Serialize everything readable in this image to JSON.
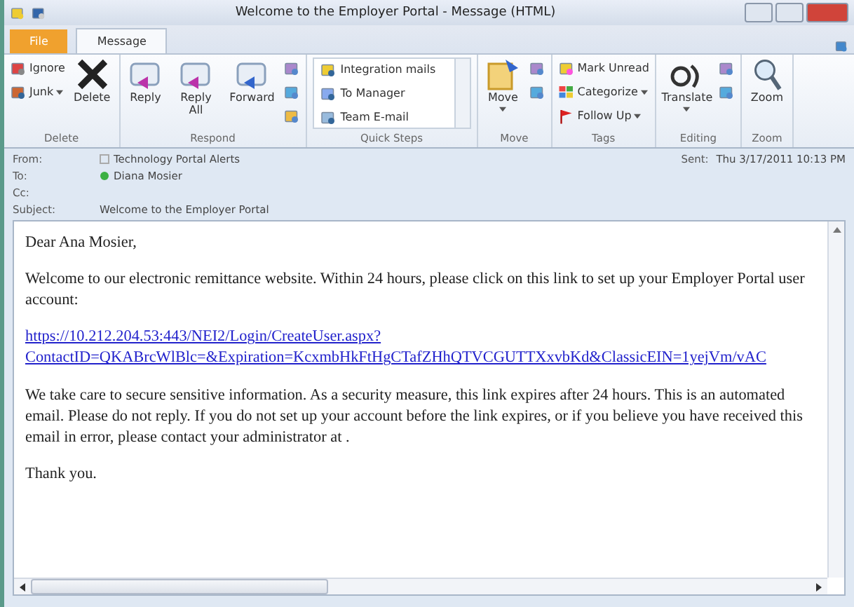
{
  "window": {
    "title": "Welcome to the Employer Portal  -  Message (HTML)"
  },
  "tabs": [
    {
      "label": "File",
      "kind": "file",
      "selected": false
    },
    {
      "label": "Message",
      "kind": "tab",
      "selected": true
    }
  ],
  "ribbon": [
    {
      "name": "Delete",
      "items": [
        {
          "label": "Ignore",
          "kind": "small"
        },
        {
          "label": "Junk",
          "kind": "small",
          "dropdown": true
        },
        {
          "label": "Delete",
          "kind": "large"
        }
      ]
    },
    {
      "name": "Respond",
      "items": [
        {
          "label": "Reply",
          "kind": "large"
        },
        {
          "label": "Reply All",
          "kind": "large"
        },
        {
          "label": "Forward",
          "kind": "large"
        }
      ]
    },
    {
      "name": "Quick Steps",
      "items": [
        {
          "label": "Integration mails",
          "kind": "quick"
        },
        {
          "label": "To Manager",
          "kind": "quick"
        },
        {
          "label": "Team E-mail",
          "kind": "quick"
        }
      ]
    },
    {
      "name": "Move",
      "items": [
        {
          "label": "Move",
          "kind": "large",
          "dropdown": true
        }
      ]
    },
    {
      "name": "Tags",
      "items": [
        {
          "label": "Mark Unread",
          "kind": "small"
        },
        {
          "label": "Categorize",
          "kind": "small",
          "dropdown": true
        },
        {
          "label": "Follow Up",
          "kind": "small",
          "dropdown": true
        }
      ]
    },
    {
      "name": "Editing",
      "items": [
        {
          "label": "Translate",
          "kind": "large",
          "dropdown": true
        }
      ]
    },
    {
      "name": "Zoom",
      "items": [
        {
          "label": "Zoom",
          "kind": "large"
        }
      ]
    }
  ],
  "header": {
    "from_label": "From:",
    "from": "Technology Portal Alerts",
    "to_label": "To:",
    "to": "Diana Mosier",
    "cc_label": "Cc:",
    "subject_label": "Subject:",
    "subject": "Welcome to the Employer Portal",
    "sent_label": "Sent:",
    "sent": "Thu 3/17/2011 10:13 PM"
  },
  "body": {
    "greeting": "Dear Ana Mosier,",
    "intro": "Welcome to our electronic remittance website. Within 24 hours, please click on this link to set up your Employer Portal user account:",
    "link_lines": [
      "https://10.212.204.53:443/NEI2/Login/CreateUser.aspx?",
      "ContactID=QKABrcWlBlc=&Expiration=KcxmbHkFtHgCTafZHhQTVCGUTTXxvbKd&ClassicEIN=1yejVm/vAC"
    ],
    "notice": "We take care to secure sensitive information. As a security measure, this link expires after 24 hours. This is an automated email. Please do not reply. If you do not set up your account before the link expires, or if you believe you have received this email in error, please contact your administrator at .",
    "closing": "Thank you."
  }
}
